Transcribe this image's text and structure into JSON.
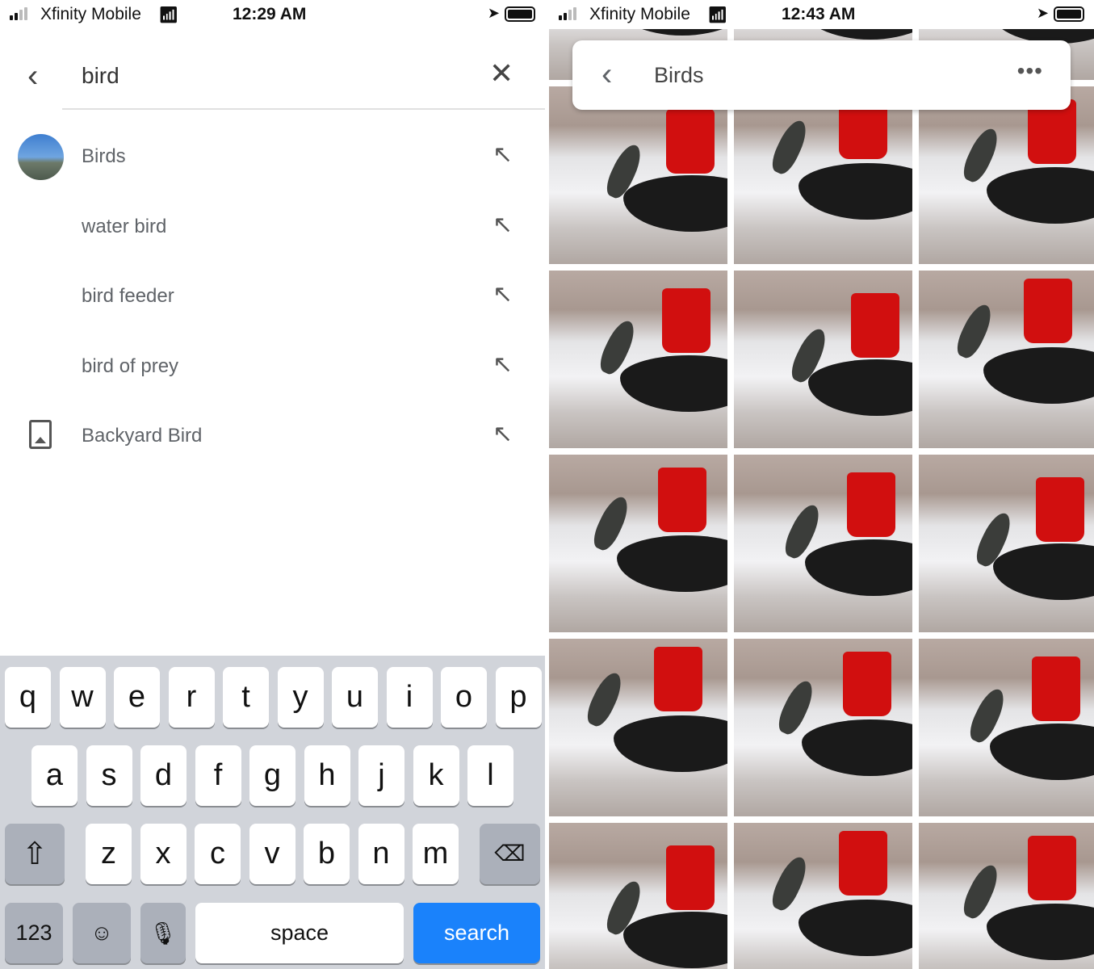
{
  "left": {
    "status": {
      "carrier": "Xfinity Mobile",
      "time": "12:29 AM"
    },
    "search": {
      "query": "bird"
    },
    "suggestions": [
      {
        "label": "Birds",
        "icon": "album-thumbnail"
      },
      {
        "label": "water bird",
        "icon": "none"
      },
      {
        "label": "bird feeder",
        "icon": "none"
      },
      {
        "label": "bird of prey",
        "icon": "none"
      },
      {
        "label": "Backyard Bird",
        "icon": "album-icon"
      }
    ],
    "keyboard": {
      "row1": [
        "q",
        "w",
        "e",
        "r",
        "t",
        "y",
        "u",
        "i",
        "o",
        "p"
      ],
      "row2": [
        "a",
        "s",
        "d",
        "f",
        "g",
        "h",
        "j",
        "k",
        "l"
      ],
      "row3": [
        "z",
        "x",
        "c",
        "v",
        "b",
        "n",
        "m"
      ],
      "numbers": "123",
      "space": "space",
      "search": "search",
      "accent": "#1a82fb"
    }
  },
  "right": {
    "status": {
      "carrier": "Xfinity Mobile",
      "time": "12:43 AM"
    },
    "header": {
      "title": "Birds",
      "more": "•••"
    },
    "photo_count_visible": 18
  }
}
